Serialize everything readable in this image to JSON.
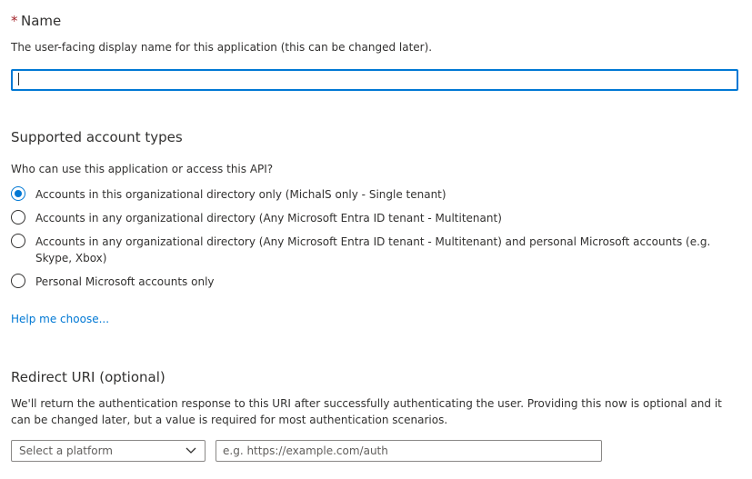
{
  "name_section": {
    "required_marker": "*",
    "title": "Name",
    "description": "The user-facing display name for this application (this can be changed later).",
    "input_value": ""
  },
  "account_types": {
    "title": "Supported account types",
    "question": "Who can use this application or access this API?",
    "options": [
      {
        "label": "Accounts in this organizational directory only (MichalS only - Single tenant)",
        "selected": true
      },
      {
        "label": "Accounts in any organizational directory (Any Microsoft Entra ID tenant - Multitenant)",
        "selected": false
      },
      {
        "label": "Accounts in any organizational directory (Any Microsoft Entra ID tenant - Multitenant) and personal Microsoft accounts (e.g. Skype, Xbox)",
        "selected": false
      },
      {
        "label": "Personal Microsoft accounts only",
        "selected": false
      }
    ],
    "help_link": "Help me choose..."
  },
  "redirect": {
    "title": "Redirect URI (optional)",
    "description": "We'll return the authentication response to this URI after successfully authenticating the user. Providing this now is optional and it can be changed later, but a value is required for most authentication scenarios.",
    "platform_placeholder": "Select a platform",
    "uri_placeholder": "e.g. https://example.com/auth"
  },
  "colors": {
    "accent": "#0078d4",
    "required": "#a4262c",
    "text": "#323130"
  }
}
